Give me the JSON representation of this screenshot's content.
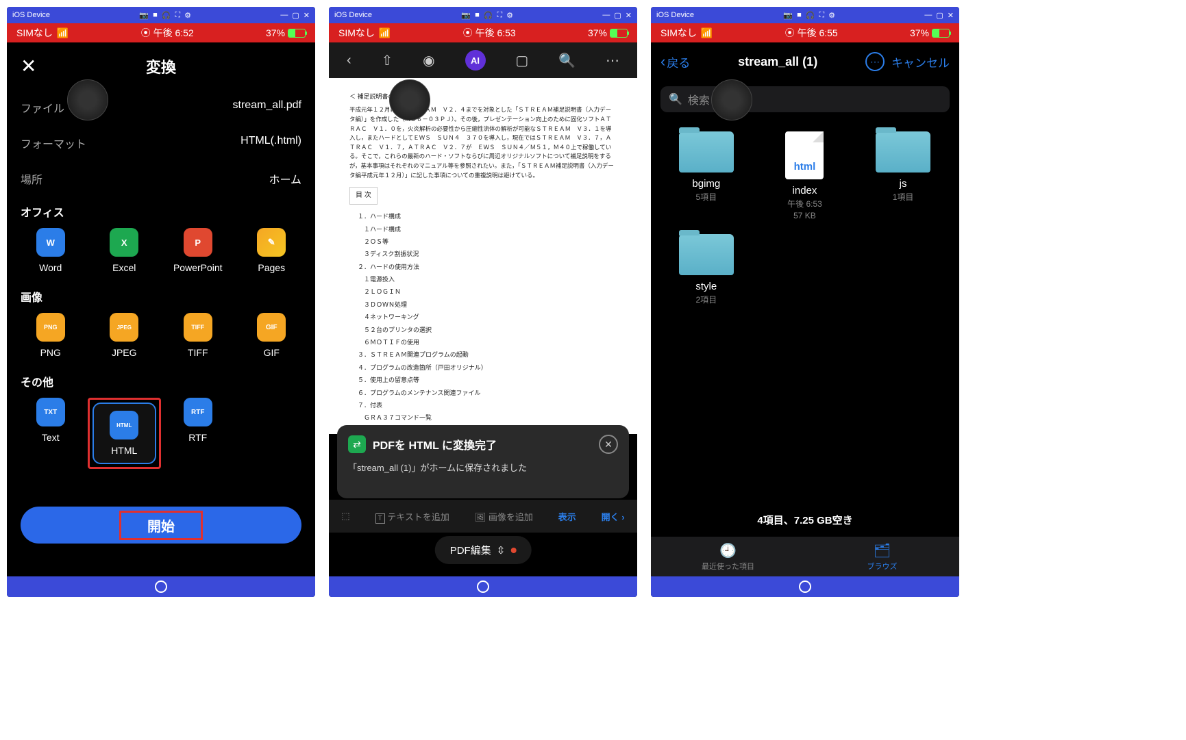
{
  "emu": {
    "title": "iOS Device"
  },
  "status": {
    "sim": "SIMなし",
    "time1": "午後 6:52",
    "time2": "午後 6:53",
    "time3": "午後 6:55",
    "batt": "37%"
  },
  "p1": {
    "title": "変換",
    "rows": {
      "file_label": "ファイル",
      "file_value": "stream_all.pdf",
      "format_label": "フォーマット",
      "format_value": "HTML(.html)",
      "location_label": "場所",
      "location_value": "ホーム"
    },
    "section_office": "オフィス",
    "office": {
      "word": "Word",
      "excel": "Excel",
      "ppt": "PowerPoint",
      "pages": "Pages"
    },
    "section_image": "画像",
    "image": {
      "png": "PNG",
      "jpeg": "JPEG",
      "tiff": "TIFF",
      "gif": "GIF"
    },
    "section_other": "その他",
    "other": {
      "text": "Text",
      "html": "HTML",
      "rtf": "RTF"
    },
    "start": "開始"
  },
  "p2": {
    "ai": "AI",
    "doc_head": "＜ 補足説明書の位置付け ＞",
    "doc_para": "平成元年１２月に，ＳＴＲＥＡＭ　Ｖ２．４までを対象とした「ＳＴＲＥＡＭ補足説明書（入力データ編）」を作成した（Ｍ６６－０３ＰＪ）。その後，プレゼンテーション向上のために固化ソフトＡＴＲＡＣ　Ｖ１．０を，火炎解析の必要性から圧縮性流体の解析が可能なＳＴＲＥＡＭ　Ｖ３．１を導入し，またハードとしてＥＷＳ　ＳＵＮ４　３７０を導入し，現在ではＳＴＲＥＡＭ　Ｖ３．７，ＡＴＲＡＣ　Ｖ１．７，ＡＴＲＡＣ　Ｖ２．７が　ＥＷＳ　ＳＵＮ４／Ｍ５１，Ｍ４０上で稼働している。そこで，これらの最新のハード・ソフトならびに周辺オリジナルソフトについて補足説明をするが，基本事項はそれぞれのマニュアル等を参照されたい。また，「ＳＴＲＥＡＭ補足説明書（入力データ編平成元年１２月）」に記した事項についての重複説明は避けている。",
    "toc_label": "目 次",
    "toc": [
      "１．ハード構成",
      "　１ハード構成",
      "　２ＯＳ等",
      "　３ディスク割振状況",
      "２．ハードの使用方法",
      "　１電源投入",
      "　２ＬＯＧＩＮ",
      "　３ＤＯＷＮ処理",
      "　４ネットワーキング",
      "　５２台のプリンタの選択",
      "　６ＭＯＴＩＦの使用",
      "３．ＳＴＲＥＡＭ関連プログラムの起動",
      "４．プログラムの改造箇所（戸田オリジナル）",
      "５．使用上の留意点等",
      "６．プログラムのメンテナンス関連ファイル",
      "７．付表",
      "　ＧＲＡ３７コマンド一覧"
    ],
    "toast_title": "PDFを HTML に変換完了",
    "toast_sub": "「stream_all (1)」がホームに保存されました",
    "act_text": "テキストを追加",
    "act_image": "画像を追加",
    "act_show": "表示",
    "act_open": "開く",
    "pdfedit": "PDF編集"
  },
  "p3": {
    "back": "戻る",
    "title": "stream_all (1)",
    "cancel": "キャンセル",
    "search_ph": "検索",
    "files": [
      {
        "name": "bgimg",
        "sub": "5項目",
        "type": "folder"
      },
      {
        "name": "index",
        "sub": "午後 6:53",
        "sub2": "57 KB",
        "type": "html"
      },
      {
        "name": "js",
        "sub": "1項目",
        "type": "folder"
      },
      {
        "name": "style",
        "sub": "2項目",
        "type": "folder"
      }
    ],
    "footer": "4項目、7.25 GB空き",
    "tab_recent": "最近使った項目",
    "tab_browse": "ブラウズ"
  }
}
